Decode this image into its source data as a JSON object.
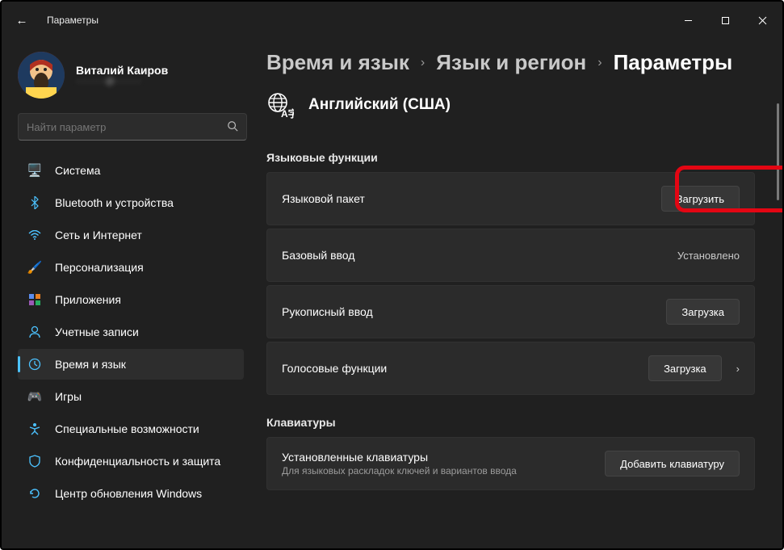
{
  "window": {
    "title": "Параметры"
  },
  "user": {
    "name": "Виталий Каиров",
    "email": "··········@·········"
  },
  "search": {
    "placeholder": "Найти параметр"
  },
  "sidebar": {
    "items": [
      {
        "label": "Система"
      },
      {
        "label": "Bluetooth и устройства"
      },
      {
        "label": "Сеть и Интернет"
      },
      {
        "label": "Персонализация"
      },
      {
        "label": "Приложения"
      },
      {
        "label": "Учетные записи"
      },
      {
        "label": "Время и язык"
      },
      {
        "label": "Игры"
      },
      {
        "label": "Специальные возможности"
      },
      {
        "label": "Конфиденциальность и защита"
      },
      {
        "label": "Центр обновления Windows"
      }
    ]
  },
  "breadcrumb": {
    "a": "Время и язык",
    "b": "Язык и регион",
    "c": "Параметры"
  },
  "language": {
    "title": "Английский (США)"
  },
  "sections": {
    "features": "Языковые функции",
    "keyboards": "Клавиатуры"
  },
  "cards": {
    "pack": {
      "title": "Языковой пакет",
      "action": "Загрузить"
    },
    "basic": {
      "title": "Базовый ввод",
      "status": "Установлено"
    },
    "hand": {
      "title": "Рукописный ввод",
      "action": "Загрузка"
    },
    "voice": {
      "title": "Голосовые функции",
      "action": "Загрузка"
    },
    "kbd": {
      "title": "Установленные клавиатуры",
      "sub": "Для языковых раскладок ключей и вариантов ввода",
      "action": "Добавить клавиатуру"
    }
  }
}
